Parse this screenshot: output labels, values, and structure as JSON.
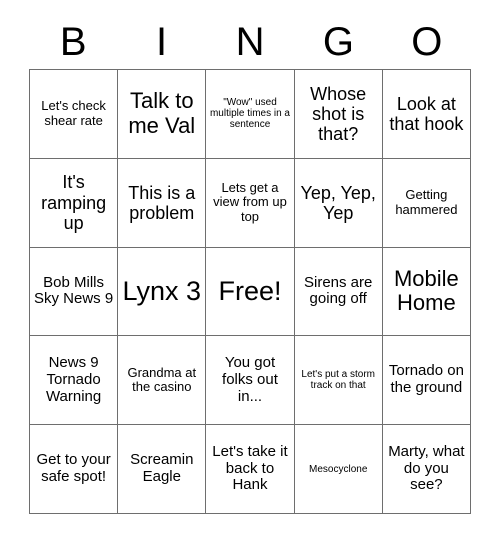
{
  "card": {
    "title": "BINGO",
    "header_letters": [
      "B",
      "I",
      "N",
      "G",
      "O"
    ],
    "grid_size": "5x5",
    "free_space": "Free!",
    "colors": {
      "background": "#ffffff",
      "text": "#000000",
      "grid_line": "#6e6e6e"
    },
    "cells": [
      {
        "row": 1,
        "col": 1,
        "column_letter": "B",
        "text": "Let's check shear rate",
        "size": "sm",
        "free": false
      },
      {
        "row": 1,
        "col": 2,
        "column_letter": "I",
        "text": "Talk to me Val",
        "size": "xl",
        "free": false
      },
      {
        "row": 1,
        "col": 3,
        "column_letter": "N",
        "text": "\"Wow\" used multiple times in a sentence",
        "size": "xs",
        "free": false
      },
      {
        "row": 1,
        "col": 4,
        "column_letter": "G",
        "text": "Whose shot is that?",
        "size": "lg",
        "free": false
      },
      {
        "row": 1,
        "col": 5,
        "column_letter": "O",
        "text": "Look at that hook",
        "size": "lg",
        "free": false
      },
      {
        "row": 2,
        "col": 1,
        "column_letter": "B",
        "text": "It's ramping up",
        "size": "lg",
        "free": false
      },
      {
        "row": 2,
        "col": 2,
        "column_letter": "I",
        "text": "This is a problem",
        "size": "lg",
        "free": false
      },
      {
        "row": 2,
        "col": 3,
        "column_letter": "N",
        "text": "Lets get a view from up top",
        "size": "sm",
        "free": false
      },
      {
        "row": 2,
        "col": 4,
        "column_letter": "G",
        "text": "Yep, Yep, Yep",
        "size": "lg",
        "free": false
      },
      {
        "row": 2,
        "col": 5,
        "column_letter": "O",
        "text": "Getting hammered",
        "size": "sm",
        "free": false
      },
      {
        "row": 3,
        "col": 1,
        "column_letter": "B",
        "text": "Bob Mills Sky News 9",
        "size": "md",
        "free": false
      },
      {
        "row": 3,
        "col": 2,
        "column_letter": "I",
        "text": "Lynx 3",
        "size": "xxl",
        "free": false
      },
      {
        "row": 3,
        "col": 3,
        "column_letter": "N",
        "text": "Free!",
        "size": "xxl",
        "free": true
      },
      {
        "row": 3,
        "col": 4,
        "column_letter": "G",
        "text": "Sirens are going off",
        "size": "md",
        "free": false
      },
      {
        "row": 3,
        "col": 5,
        "column_letter": "O",
        "text": "Mobile Home",
        "size": "xl",
        "free": false
      },
      {
        "row": 4,
        "col": 1,
        "column_letter": "B",
        "text": "News 9 Tornado Warning",
        "size": "md",
        "free": false
      },
      {
        "row": 4,
        "col": 2,
        "column_letter": "I",
        "text": "Grandma at the casino",
        "size": "sm",
        "free": false
      },
      {
        "row": 4,
        "col": 3,
        "column_letter": "N",
        "text": "You got folks out in...",
        "size": "md",
        "free": false
      },
      {
        "row": 4,
        "col": 4,
        "column_letter": "G",
        "text": "Let's put a storm track on that",
        "size": "xs",
        "free": false
      },
      {
        "row": 4,
        "col": 5,
        "column_letter": "O",
        "text": "Tornado on the ground",
        "size": "md",
        "free": false
      },
      {
        "row": 5,
        "col": 1,
        "column_letter": "B",
        "text": "Get to your safe spot!",
        "size": "md",
        "free": false
      },
      {
        "row": 5,
        "col": 2,
        "column_letter": "I",
        "text": "Screamin Eagle",
        "size": "md",
        "free": false
      },
      {
        "row": 5,
        "col": 3,
        "column_letter": "N",
        "text": "Let's take it back to Hank",
        "size": "md",
        "free": false
      },
      {
        "row": 5,
        "col": 4,
        "column_letter": "G",
        "text": "Mesocyclone",
        "size": "xs",
        "free": false
      },
      {
        "row": 5,
        "col": 5,
        "column_letter": "O",
        "text": "Marty, what do you see?",
        "size": "md",
        "free": false
      }
    ]
  }
}
